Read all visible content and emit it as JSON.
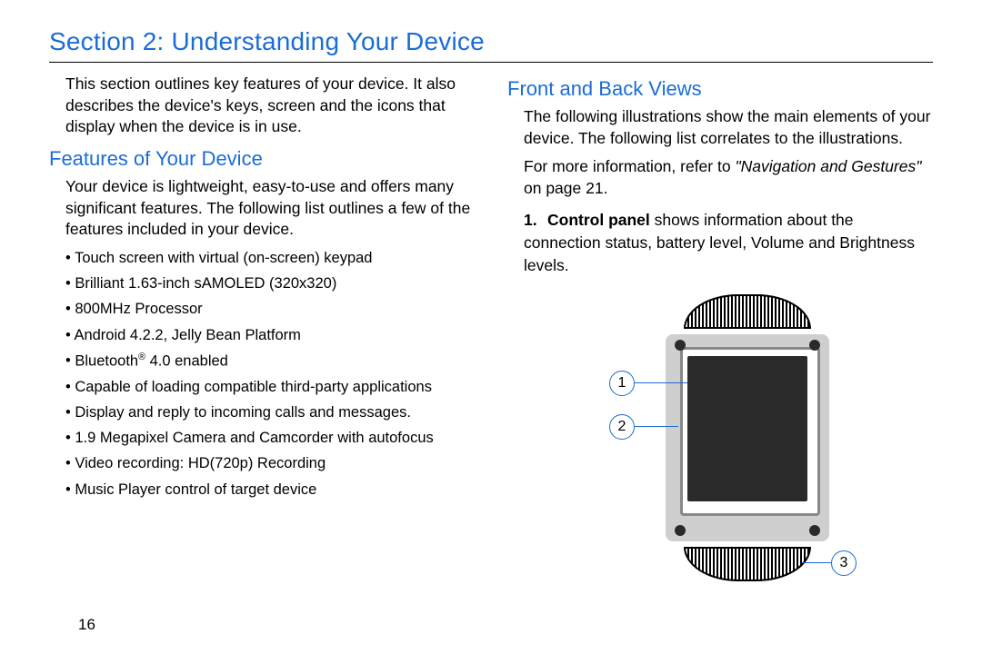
{
  "section_title": "Section 2: Understanding Your Device",
  "page_number": "16",
  "left": {
    "intro": "This section outlines key features of your device. It also describes the device's keys, screen and the icons that display when the device is in use.",
    "heading": "Features of Your Device",
    "body": "Your device is lightweight, easy-to-use and offers many significant features. The following list outlines a few of the features included in your device.",
    "features": [
      "Touch screen with virtual (on-screen) keypad",
      "Brilliant 1.63-inch sAMOLED (320x320)",
      "800MHz Processor",
      "Android 4.2.2, Jelly Bean Platform",
      "Bluetooth® 4.0 enabled",
      "Capable of loading compatible third-party applications",
      "Display and reply to incoming calls and messages.",
      "1.9 Megapixel Camera and Camcorder with autofocus",
      "Video recording: HD(720p) Recording",
      "Music Player control of target device"
    ]
  },
  "right": {
    "heading": "Front and Back Views",
    "p1": "The following illustrations show the main elements of your device. The following list correlates to the illustrations.",
    "p2_pre": "For more information, refer to ",
    "p2_link": "\"Navigation and Gestures\"",
    "p2_post": " on page 21.",
    "item1_num": "1.",
    "item1_bold": "Control panel",
    "item1_rest": " shows information about the connection status, battery level, Volume and Brightness levels.",
    "callouts": {
      "c1": "1",
      "c2": "2",
      "c3": "3"
    }
  }
}
